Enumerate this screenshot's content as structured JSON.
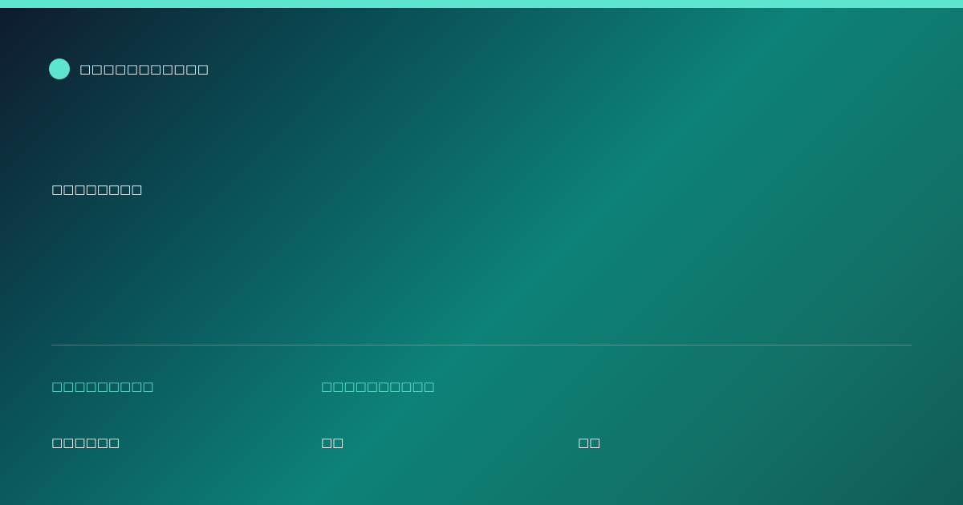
{
  "colors": {
    "accent": "#5ee5cf",
    "text": "#ffffff",
    "divider": "rgba(255,255,255,0.25)"
  },
  "header": {
    "brand_icon": "circle-dot-icon",
    "brand_name": "□□□□□□□□□□□"
  },
  "main": {
    "subtitle": "□□□□□□□□"
  },
  "footer": {
    "labels": [
      "□□□□□□□□□",
      "□□□□□□□□□□"
    ],
    "values": [
      "□□□□□□",
      "□□",
      "□□"
    ]
  }
}
